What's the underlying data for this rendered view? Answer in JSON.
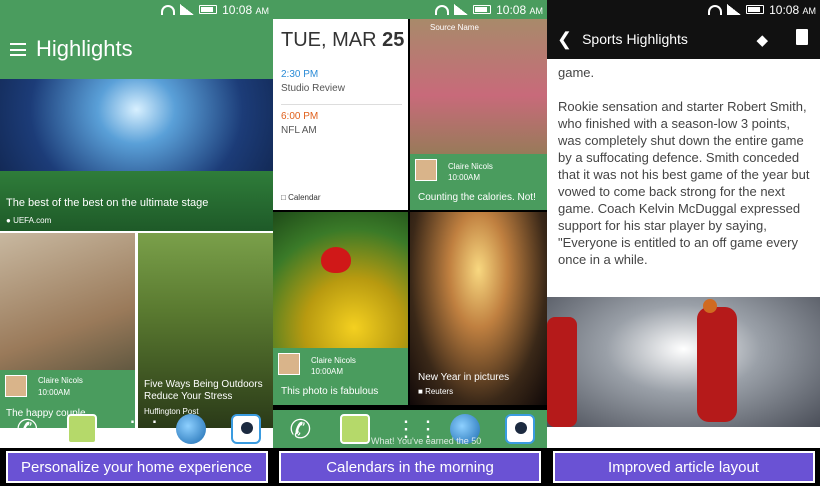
{
  "status": {
    "time": "10:08",
    "ampm": "AM"
  },
  "panel1": {
    "title": "Highlights",
    "hero": {
      "caption": "The best of the best on the ultimate stage",
      "source": "UEFA.com"
    },
    "tile_left": {
      "user": "Claire Nicols",
      "time": "10:00AM",
      "title": "The happy couple"
    },
    "tile_right": {
      "title": "Five Ways Being Outdoors Reduce Your Stress",
      "source": "Huffington Post"
    },
    "caption": "Personalize your home experience"
  },
  "panel2": {
    "date_prefix": "TUE, MAR",
    "date_day": "25",
    "events": [
      {
        "time": "2:30 PM",
        "title": "Studio Review",
        "color": "#2b8bd6"
      },
      {
        "time": "6:00 PM",
        "title": "NFL AM",
        "color": "#e0601c"
      }
    ],
    "calendar_label": "Calendar",
    "woman_tile": {
      "source_name": "Source Name",
      "user": "Claire Nicols",
      "time": "10:00AM",
      "title": "Counting the calories. Not!"
    },
    "ladybug_tile": {
      "user": "Claire Nicols",
      "time": "10:00AM",
      "title": "This photo is fabulous"
    },
    "tree_tile": {
      "title": "New Year in pictures",
      "source": "Reuters"
    },
    "dock_hint": "What! You've earned the 50",
    "caption": "Calendars in the morning"
  },
  "panel3": {
    "title": "Sports Highlights",
    "article_lead": "game.",
    "article_body": "Rookie sensation and starter Robert Smith, who finished with a season-low 3 points, was completely shut down the entire game by a suffocating defence. Smith conceded that it was not his best game of the year but vowed to come back strong for the next game. Coach Kelvin McDuggal expressed support for his star player by saying, \"Everyone is entitled to an off game every once in a while.",
    "caption": "Improved article layout"
  }
}
